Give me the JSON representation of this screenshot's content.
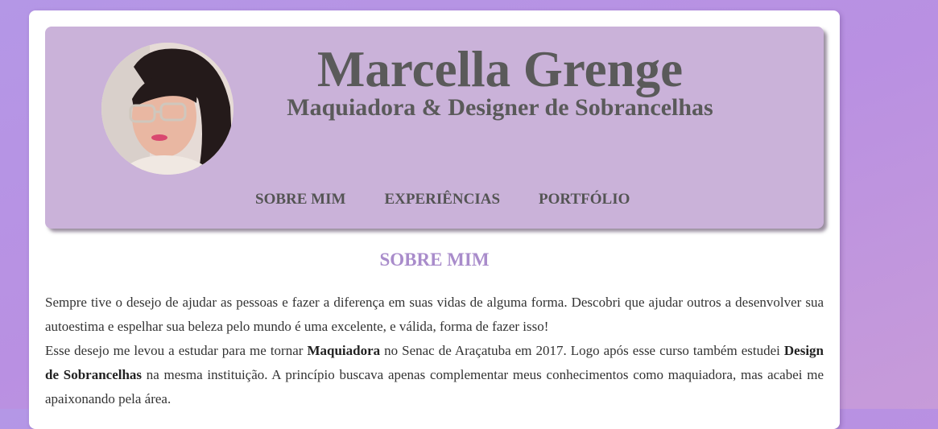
{
  "header": {
    "name": "Marcella Grenge",
    "subtitle": "Maquiadora & Designer de Sobrancelhas",
    "avatar_alt": "profile-photo"
  },
  "nav": {
    "items": [
      {
        "label": "SOBRE MIM"
      },
      {
        "label": "EXPERIÊNCIAS"
      },
      {
        "label": "PORTFÓLIO"
      }
    ]
  },
  "about": {
    "heading": "SOBRE MIM",
    "p1": "Sempre tive o desejo de ajudar as pessoas e fazer a diferença em suas vidas de alguma forma. Descobri que ajudar outros a desenvolver sua autoestima e espelhar sua beleza pelo mundo é uma excelente, e válida, forma de fazer isso!",
    "p2_a": "Esse desejo me levou a estudar para me tornar ",
    "p2_b": "Maquiadora",
    "p2_c": " no Senac de Araçatuba em 2017. Logo após esse curso também estudei ",
    "p2_d": "Design de Sobrancelhas",
    "p2_e": " na mesma instituição. A princípio buscava apenas complementar meus conhecimentos como maquiadora, mas acabei me apaixonando pela área."
  },
  "colors": {
    "background": "#b794e4",
    "header": "#cab2d9",
    "accent": "#a98ccb",
    "text": "#333333"
  }
}
